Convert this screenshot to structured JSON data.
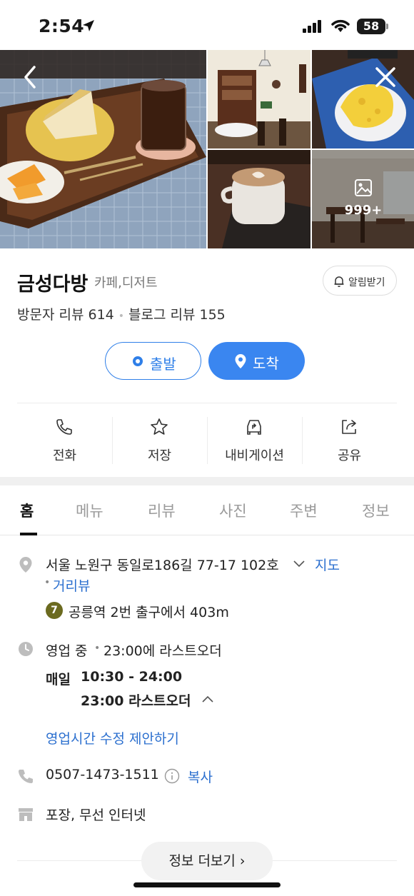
{
  "status_bar": {
    "time": "2:54",
    "battery": "58"
  },
  "photos": {
    "more_count": "999+"
  },
  "place": {
    "name": "금성다방",
    "category": "카페,디저트",
    "alarm_label": "알림받기",
    "visitor_reviews": "방문자 리뷰 614",
    "blog_reviews": "블로그 리뷰 155"
  },
  "route": {
    "start_label": "출발",
    "end_label": "도착"
  },
  "actions": [
    {
      "label": "전화",
      "icon": "phone-icon"
    },
    {
      "label": "저장",
      "icon": "star-icon"
    },
    {
      "label": "내비게이션",
      "icon": "car-navigation-icon"
    },
    {
      "label": "공유",
      "icon": "share-icon"
    }
  ],
  "tabs": [
    "홈",
    "메뉴",
    "리뷰",
    "사진",
    "주변",
    "정보"
  ],
  "info": {
    "address": "서울 노원구 동일로186길 77-17 102호",
    "map_link": "지도",
    "street_view_link": "거리뷰",
    "subway_line": "7",
    "subway_text": "공릉역 2번 출구에서 403m",
    "open_status": "영업 중",
    "last_order_summary": "23:00에 라스트오더",
    "hours_day": "매일",
    "hours_time": "10:30 - 24:00",
    "hours_last_order": "23:00 라스트오더",
    "suggest_edit": "영업시간 수정 제안하기",
    "phone": "0507-1473-1511",
    "copy_label": "복사",
    "amenities": "포장, 무선 인터넷",
    "more_info_button": "정보 더보기 ›"
  },
  "colors": {
    "accent_blue": "#3a86f0",
    "link_blue": "#2b6fcf",
    "subway_line7": "#6b6a1f"
  }
}
